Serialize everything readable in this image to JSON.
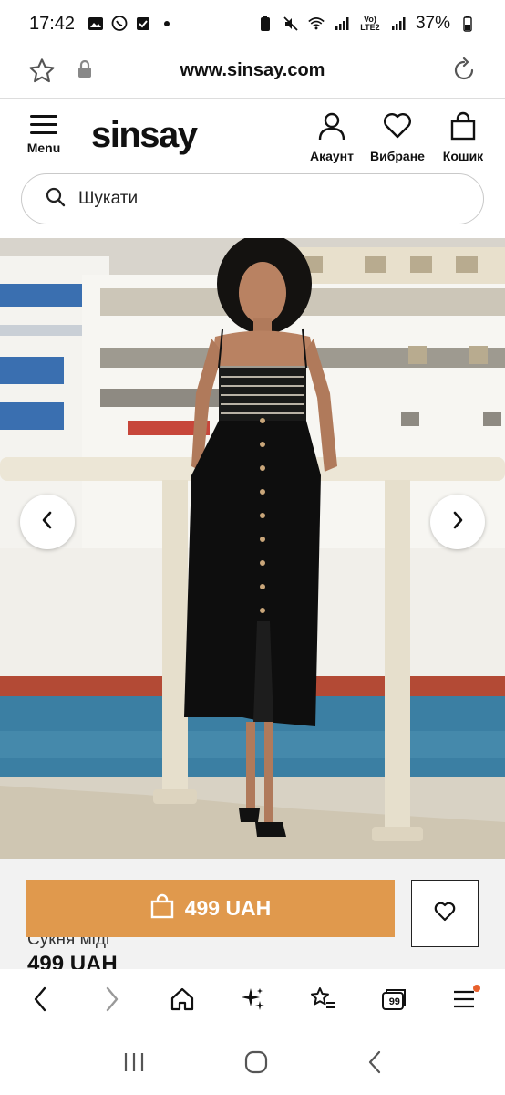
{
  "status": {
    "time": "17:42",
    "network": "Vo) LTE2",
    "battery": "37%"
  },
  "browser": {
    "url": "www.sinsay.com",
    "tab_count": "99"
  },
  "header": {
    "menu_label": "Menu",
    "logo": "sinsay",
    "account_label": "Акаунт",
    "wishlist_label": "Вибране",
    "cart_label": "Кошик"
  },
  "search": {
    "placeholder": "Шукати"
  },
  "product": {
    "buy_label": "499 UAH",
    "name_partial": "Сукня міді",
    "price": "499 UAH"
  },
  "colors": {
    "accent": "#e0994d",
    "notification": "#e8602c"
  },
  "icons": {
    "star": "star-icon",
    "lock": "lock-icon",
    "reload": "reload-icon",
    "account": "user-icon",
    "wishlist": "heart-icon",
    "cart": "bag-icon",
    "search": "search-icon",
    "back": "chevron-left-icon",
    "forward": "chevron-right-icon",
    "home": "home-icon",
    "ai": "sparkle-icon",
    "bookmarks": "star-list-icon",
    "tabs": "tabs-icon",
    "menu": "hamburger-icon"
  }
}
